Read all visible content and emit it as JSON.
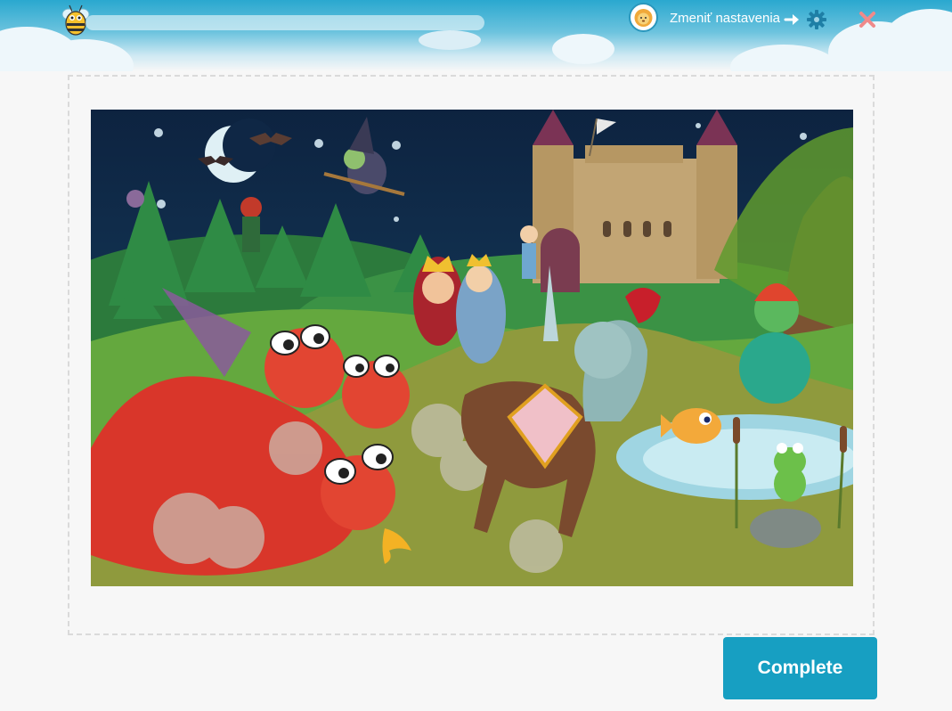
{
  "header": {
    "settings_label": "Zmeniť nastavenia",
    "progress": 0,
    "icons": {
      "logo": "bee-icon",
      "avatar": "lion-avatar-icon",
      "arrow": "arrow-right-icon",
      "settings": "gear-icon",
      "close": "close-icon"
    }
  },
  "footer": {
    "complete_label": "Complete"
  },
  "colors": {
    "header_top": "#2aa8cf",
    "button": "#179fc2",
    "close": "#f08a8a",
    "gear": "#1e7fa6"
  }
}
